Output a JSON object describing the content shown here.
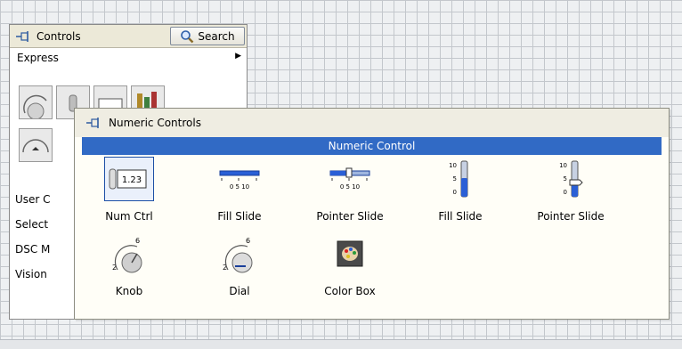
{
  "controls_palette": {
    "title": "Controls",
    "search_label": "Search",
    "express_label": "Express",
    "list_items": [
      "User C",
      "Select",
      "DSC M",
      "Vision"
    ]
  },
  "numeric_palette": {
    "title": "Numeric Controls",
    "header": "Numeric Control",
    "items": [
      {
        "label": "Num Ctrl",
        "icon": "numeric-control-icon",
        "value_text": "1.23"
      },
      {
        "label": "Fill Slide",
        "icon": "horizontal-fill-slide-icon",
        "ticks": "0 5 10"
      },
      {
        "label": "Pointer Slide",
        "icon": "horizontal-pointer-slide-icon",
        "ticks": "0 5 10"
      },
      {
        "label": "Fill Slide",
        "icon": "vertical-fill-slide-icon",
        "ticks": [
          "10",
          "5",
          "0"
        ]
      },
      {
        "label": "Pointer Slide",
        "icon": "vertical-pointer-slide-icon",
        "ticks": [
          "10",
          "5",
          "0"
        ]
      },
      {
        "label": "Knob",
        "icon": "knob-icon",
        "ticks": [
          "6",
          "2"
        ]
      },
      {
        "label": "Dial",
        "icon": "dial-icon",
        "ticks": [
          "6",
          "2"
        ]
      },
      {
        "label": "Color Box",
        "icon": "color-box-icon"
      }
    ]
  },
  "colors": {
    "selection_bar": "#316ac5",
    "slide_fill": "#2a5fd6",
    "palette_bg": "#fffef7",
    "grid_line": "#c3c7cc"
  }
}
